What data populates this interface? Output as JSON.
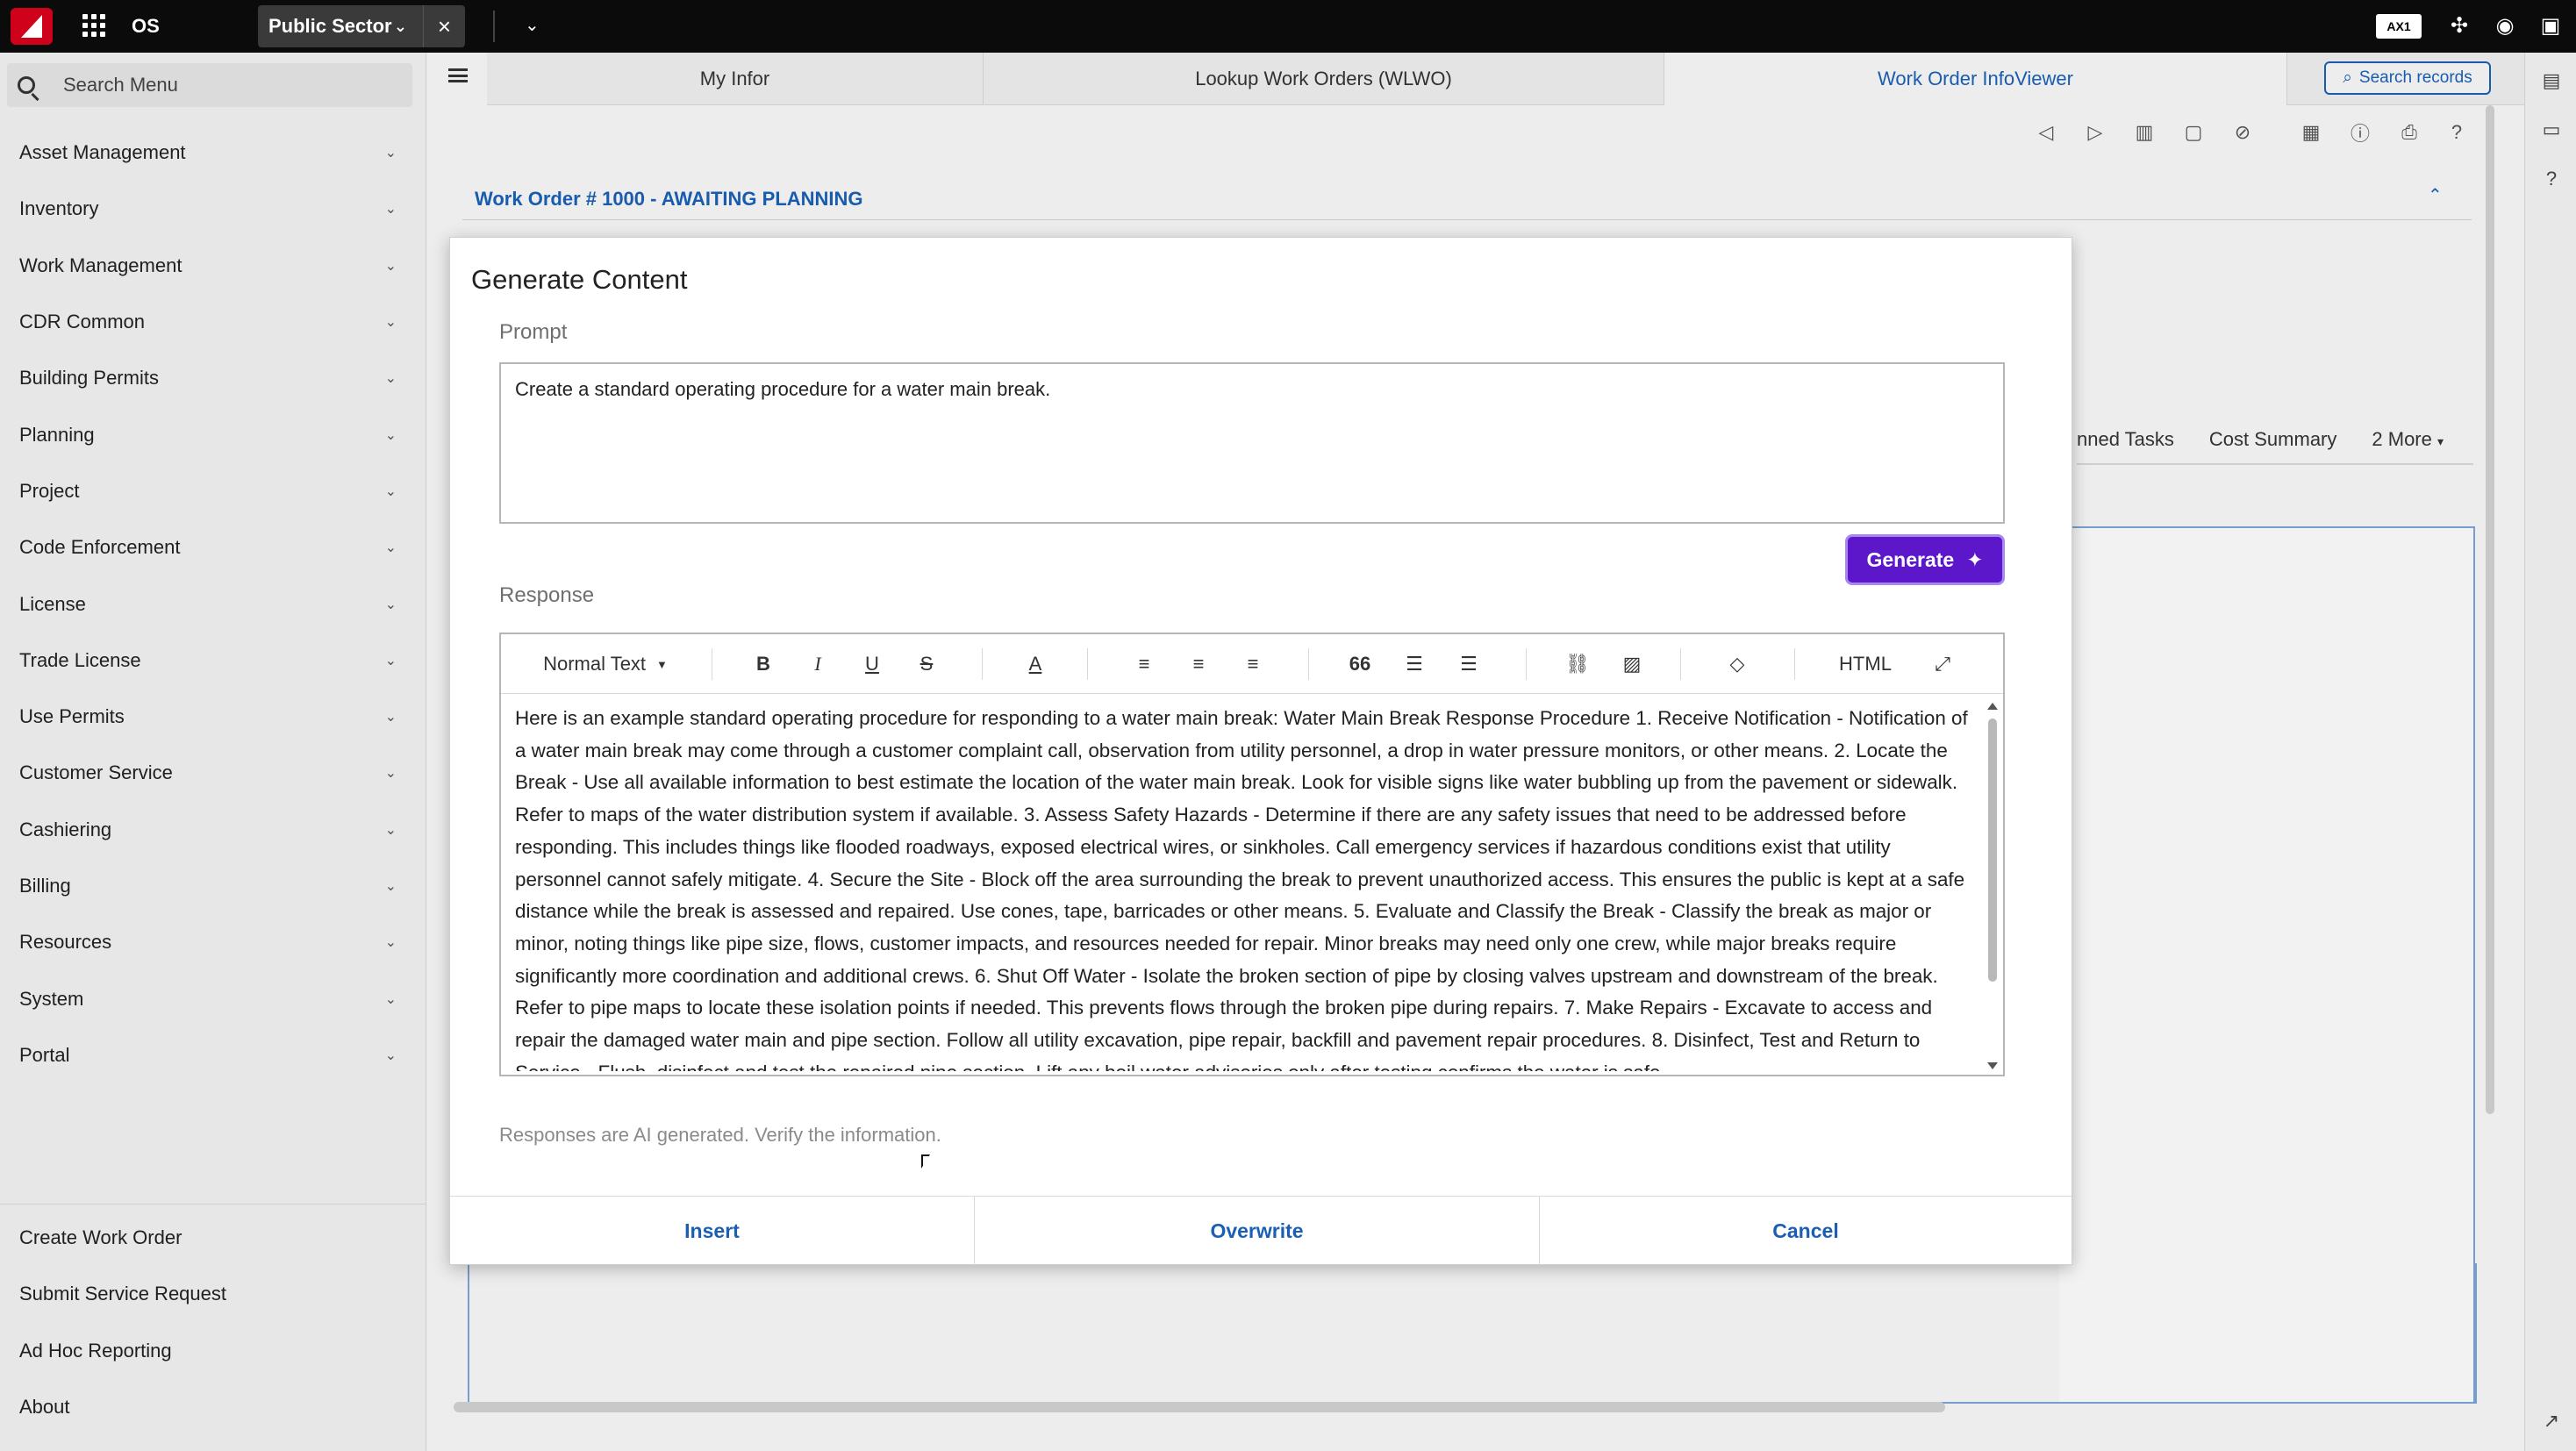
{
  "topbar": {
    "os_label": "OS",
    "context": "Public Sector",
    "ax_badge": "AX1"
  },
  "sidebar": {
    "search_label": "Search Menu",
    "items": [
      {
        "label": "Asset Management"
      },
      {
        "label": "Inventory"
      },
      {
        "label": "Work Management"
      },
      {
        "label": "CDR Common"
      },
      {
        "label": "Building Permits"
      },
      {
        "label": "Planning"
      },
      {
        "label": "Project"
      },
      {
        "label": "Code Enforcement"
      },
      {
        "label": "License"
      },
      {
        "label": "Trade License"
      },
      {
        "label": "Use Permits"
      },
      {
        "label": "Customer Service"
      },
      {
        "label": "Cashiering"
      },
      {
        "label": "Billing"
      },
      {
        "label": "Resources"
      },
      {
        "label": "System"
      },
      {
        "label": "Portal"
      }
    ],
    "bottom_items": [
      {
        "label": "Create Work Order"
      },
      {
        "label": "Submit Service Request"
      },
      {
        "label": "Ad Hoc Reporting"
      },
      {
        "label": "About"
      }
    ]
  },
  "main": {
    "tabs": [
      {
        "label": "My Infor"
      },
      {
        "label": "Lookup Work Orders (WLWO)"
      },
      {
        "label": "Work Order InfoViewer"
      }
    ],
    "search_records": "Search records",
    "wo_title": "Work Order # 1000 - AWAITING PLANNING",
    "bg_tabs": {
      "tab1": "nned Tasks",
      "tab2": "Cost Summary",
      "tab3": "2 More"
    }
  },
  "dialog": {
    "title": "Generate Content",
    "prompt_label": "Prompt",
    "prompt_value": "Create a standard operating procedure for a water main break.",
    "generate_label": "Generate",
    "response_label": "Response",
    "editor": {
      "style_select": "Normal Text",
      "quote_glyph": "66",
      "html_label": "HTML"
    },
    "response_text": "Here is an example standard operating procedure for responding to a water main break: Water Main Break Response Procedure 1. Receive Notification - Notification of a water main break may come through a customer complaint call, observation from utility personnel, a drop in water pressure monitors, or other means. 2. Locate the Break - Use all available information to best estimate the location of the water main break. Look for visible signs like water bubbling up from the pavement or sidewalk. Refer to maps of the water distribution system if available. 3. Assess Safety Hazards - Determine if there are any safety issues that need to be addressed before responding. This includes things like flooded roadways, exposed electrical wires, or sinkholes. Call emergency services if hazardous conditions exist that utility personnel cannot safely mitigate. 4. Secure the Site - Block off the area surrounding the break to prevent unauthorized access. This ensures the public is kept at a safe distance while the break is assessed and repaired. Use cones, tape, barricades or other means. 5. Evaluate and Classify the Break - Classify the break as major or minor, noting things like pipe size, flows, customer impacts, and resources needed for repair. Minor breaks may need only one crew, while major breaks require significantly more coordination and additional crews. 6. Shut Off Water - Isolate the broken section of pipe by closing valves upstream and downstream of the break. Refer to pipe maps to locate these isolation points if needed. This prevents flows through the broken pipe during repairs. 7. Make Repairs - Excavate to access and repair the damaged water main and pipe section. Follow all utility excavation, pipe repair, backfill and pavement repair procedures. 8. Disinfect, Test and Return to Service - Flush, disinfect and test the repaired pipe section. Lift any boil water advisories only after testing confirms the water is safe.",
    "disclaimer": "Responses are AI generated. Verify the information.",
    "footer": {
      "insert": "Insert",
      "overwrite": "Overwrite",
      "cancel": "Cancel"
    }
  }
}
